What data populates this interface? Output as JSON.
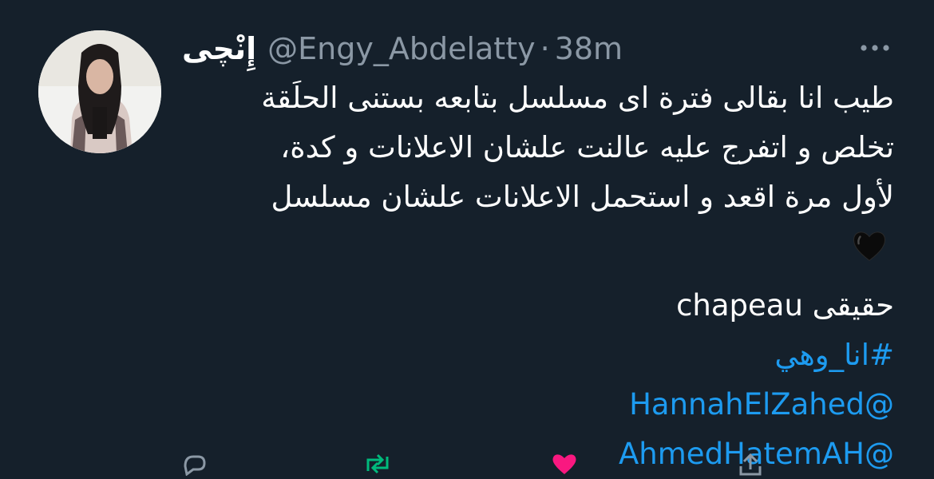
{
  "author": {
    "display_name": "إِنْچى",
    "handle": "@Engy_Abdelatty",
    "separator": "·",
    "time": "38m"
  },
  "tweet": {
    "lines": [
      "طيب انا بقالى فترة اى مسلسل بتابعه بستنى الحلَقة",
      "تخلص و اتفرج عليه عالنت علشان الاعلانات و كدة،",
      "لأول مرة اقعد و استحمل الاعلانات علشان مسلسل"
    ],
    "emoji": "black-heart",
    "line_chapeau": "حقيقى chapeau",
    "hashtag": "#انا_وهي",
    "mentions": [
      "@HannahElZahed",
      "@AhmedHatemAH"
    ]
  },
  "icons": {
    "more": "more-icon",
    "actions": [
      "reply-icon",
      "retweet-icon",
      "like-icon",
      "share-icon"
    ]
  },
  "colors": {
    "background": "#15202b",
    "text": "#ffffff",
    "muted": "#8b98a5",
    "link": "#1d9bf0",
    "like": "#f91880",
    "retweet": "#00ba7c"
  }
}
